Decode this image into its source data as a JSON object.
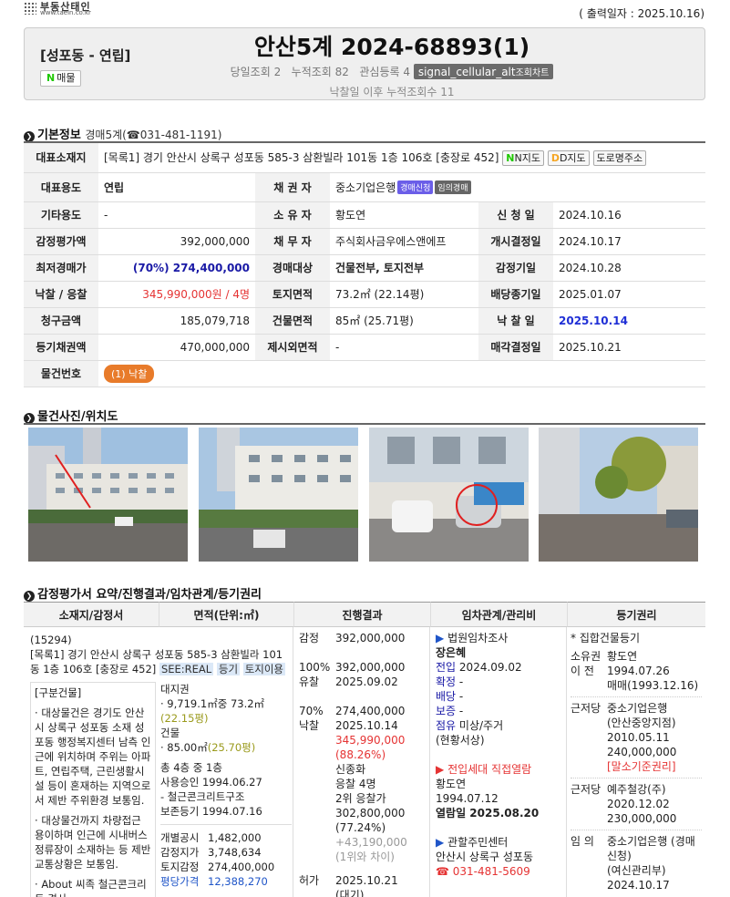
{
  "top": {
    "logo": "부동산태인",
    "logo_url": "www.taein.co.kr",
    "print_date": "( 출력일자 : 2025.10.16)"
  },
  "header": {
    "region": "[성포동 - 연립]",
    "naver_badge": "매물",
    "case_title": "안산5계 2024-68893(1)",
    "today_views": "당일조회 2",
    "total_views": "누적조회 82",
    "watch": "관심등록 4",
    "chart_icon": "signal_cellular_alt",
    "chart_label": "조회차트",
    "after_views": "낙찰일 이후 누적조회수 11"
  },
  "basic": {
    "heading": "기본정보",
    "court": "경매5계(☎031-481-1191)",
    "address_label": "대표소재지",
    "address": "[목록1] 경기 안산시 상록구 성포동 585-3 삼환빌라 101동 1층 106호 [충장로 452]",
    "map_buttons": [
      "N지도",
      "D지도",
      "도로명주소"
    ],
    "rows": [
      [
        {
          "l": "대표용도"
        },
        {
          "v": "연립",
          "b": true
        },
        {
          "l": "채 권 자"
        },
        {
          "v": "중소기업은행",
          "tags": [
            "경매신청",
            "임의경매"
          ],
          "span": 3
        }
      ],
      [
        {
          "l": "기타용도"
        },
        {
          "v": "-"
        },
        {
          "l": "소 유 자"
        },
        {
          "v": "황도연"
        },
        {
          "l": "신 청 일"
        },
        {
          "v": "2024.10.16"
        }
      ],
      [
        {
          "l": "감정평가액"
        },
        {
          "v": "392,000,000",
          "r": true
        },
        {
          "l": "채 무 자"
        },
        {
          "v": "주식회사금우에스앤에프"
        },
        {
          "l": "개시결정일"
        },
        {
          "v": "2024.10.17"
        }
      ],
      [
        {
          "l": "최저경매가"
        },
        {
          "v": "(70%) 274,400,000",
          "r": true,
          "c": "blue",
          "b": true
        },
        {
          "l": "경매대상"
        },
        {
          "v": "건물전부, 토지전부",
          "b": true
        },
        {
          "l": "감정기일"
        },
        {
          "v": "2024.10.28"
        }
      ],
      [
        {
          "l": "낙찰 / 응찰"
        },
        {
          "v": "345,990,000원 / 4명",
          "r": true,
          "c": "red"
        },
        {
          "l": "토지면적"
        },
        {
          "v": "73.2㎡ (22.14평)",
          "b2": true
        },
        {
          "l": "배당종기일"
        },
        {
          "v": "2025.01.07"
        }
      ],
      [
        {
          "l": "청구금액"
        },
        {
          "v": "185,079,718",
          "r": true
        },
        {
          "l": "건물면적"
        },
        {
          "v": "85㎡ (25.71평)",
          "b2": true
        },
        {
          "l": "낙 찰 일"
        },
        {
          "v": "2025.10.14",
          "c": "bluebold"
        }
      ],
      [
        {
          "l": "등기채권액"
        },
        {
          "v": "470,000,000",
          "r": true
        },
        {
          "l": "제시외면적"
        },
        {
          "v": "-"
        },
        {
          "l": "매각결정일"
        },
        {
          "v": "2025.10.21"
        }
      ],
      [
        {
          "l": "물건번호"
        },
        {
          "btn": "(1) 낙찰",
          "span": 5
        }
      ]
    ]
  },
  "photos_heading": "물건사진/위치도",
  "summary": {
    "heading": "감정평가서 요약/진행결과/임차관계/등기권리",
    "cols": [
      "소재지/감정서",
      "면적(단위:㎡)",
      "진행결과",
      "임차관계/관리비",
      "등기권리"
    ],
    "c1": {
      "zip": "(15294)",
      "addr": "[목록1] 경기 안산시 상록구 성포동 585-3 삼환빌라 101동 1층 106호 [충장로 452]",
      "links": [
        "SEE:REAL",
        "등기",
        "토지이용"
      ],
      "section": "[구분건물]",
      "bullets": [
        "대상물건은 경기도 안산시 상록구 성포동 소재 성포동 행정복지센터 남측 인근에 위치하며 주위는 아파트, 연립주택, 근린생활시설 등이 혼재하는 지역으로서 제반 주위환경 보통임.",
        "대상물건까지 차량접근 용이하며 인근에 시내버스정류장이 소재하는 등 제반 교통상황은 보통임.",
        "About 씨족 철근콘크리트 경사"
      ]
    },
    "c2": {
      "land": "대지권",
      "land_area": "· 9,719.1㎡중 73.2㎡",
      "land_py": "(22.15평)",
      "bldg": "건물",
      "bldg_area": "· 85.00㎡",
      "bldg_py": "(25.70평)",
      "floors": "총 4층 중 1층",
      "approval": "사용승인 1994.06.27",
      "structure": "- 철근콘크리트구조",
      "reg": "보존등기 1994.07.16",
      "price_rows": [
        [
          "개별공시",
          "1,482,000"
        ],
        [
          "감정지가",
          "3,748,634"
        ],
        [
          "토지감정",
          "274,400,000"
        ],
        [
          "평당가격",
          "12,388,270"
        ]
      ]
    },
    "c3": {
      "rows": [
        [
          "감정",
          "392,000,000"
        ],
        [
          "",
          ""
        ],
        [
          "100%",
          "392,000,000"
        ],
        [
          "유찰",
          "2025.09.02"
        ],
        [
          "",
          ""
        ],
        [
          "70%",
          "274,400,000"
        ],
        [
          "낙찰",
          "2025.10.14"
        ]
      ],
      "bid": "345,990,000",
      "bid_pct": "(88.26%)",
      "bidder": "신종화",
      "count": "응찰 4명",
      "second": "2위 응찰가",
      "second_amt": "302,800,000",
      "second_pct": "(77.24%)",
      "diff": "+43,190,000",
      "diff_label": "(1위와 차이)",
      "perm_label": "허가",
      "perm_date": "2025.10.21",
      "perm_note": "(대기)"
    },
    "c4": {
      "survey": "법원임차조사",
      "name": "장은혜",
      "move_label": "전입",
      "move": "2024.09.02",
      "conf_label": "확정",
      "conf": "-",
      "div_label": "배당",
      "div": "-",
      "dep_label": "보증",
      "dep": "-",
      "occ_label": "점유",
      "occ": "미상/주거",
      "occ2": "(현황서상)",
      "view": "전입세대 직접열람",
      "vname": "황도연",
      "vdate": "1994.07.12",
      "vlook": "열람일 2025.08.20",
      "center": "관할주민센터",
      "center_addr": "안산시 상록구 성포동",
      "center_tel": "☎ 031-481-5609"
    },
    "c5": {
      "title": "* 집합건물등기",
      "items": [
        {
          "k": "소유권\n이 전",
          "v": [
            "황도연",
            "1994.07.26",
            "매매(1993.12.16)"
          ]
        },
        {
          "k": "근저당",
          "v": [
            "중소기업은행",
            "(안산중앙지점)",
            "2010.05.11",
            "240,000,000",
            "[말소기준권리]"
          ]
        },
        {
          "k": "근저당",
          "v": [
            "예주철강(주)",
            "2020.12.02",
            "230,000,000"
          ]
        },
        {
          "k": "임 의",
          "v": [
            "중소기업은행 (경매",
            "신청)",
            "(여신관리부)",
            "2024.10.17"
          ]
        }
      ]
    }
  }
}
